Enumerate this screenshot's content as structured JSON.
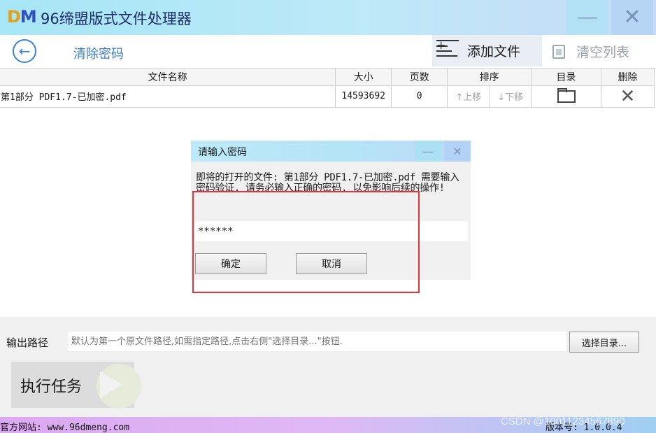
{
  "app": {
    "logo_d": "D",
    "logo_m": "M",
    "title": "96缔盟版式文件处理器",
    "minimize_glyph": "—",
    "close_glyph": "✕"
  },
  "toolbar": {
    "page_label": "清除密码",
    "add_file_label": "添加文件",
    "clear_list_label": "清空列表"
  },
  "table": {
    "headers": {
      "name": "文件名称",
      "size": "大小",
      "pages": "页数",
      "sort": "排序",
      "dir": "目录",
      "delete": "删除"
    },
    "rows": [
      {
        "name": "第1部分 PDF1.7-已加密.pdf",
        "size": "14593692",
        "pages": "0",
        "move_up": "↑上移",
        "move_down": "↓下移"
      }
    ]
  },
  "dialog": {
    "title": "请输入密码",
    "message": "即将的打开的文件: 第1部分 PDF1.7-已加密.pdf 需要输入密码验证, 请务必输入正确的密码, 以免影响后续的操作!",
    "password_value": "******",
    "ok_label": "确定",
    "cancel_label": "取消",
    "min_glyph": "—",
    "close_glyph": "✕"
  },
  "output": {
    "label": "输出路径",
    "placeholder": "默认为第一个原文件路径,如需指定路径,点击右侧\"选择目录...\"按钮.",
    "choose_label": "选择目录...",
    "run_label": "执行任务"
  },
  "status": {
    "site": "官方网站: www.96dmeng.com",
    "version": "版本号: 1.0.0.4",
    "watermark": "CSDN @10011234567890"
  },
  "colors": {
    "accent": "#3a82d8",
    "highlight_frame": "#e2343a"
  }
}
